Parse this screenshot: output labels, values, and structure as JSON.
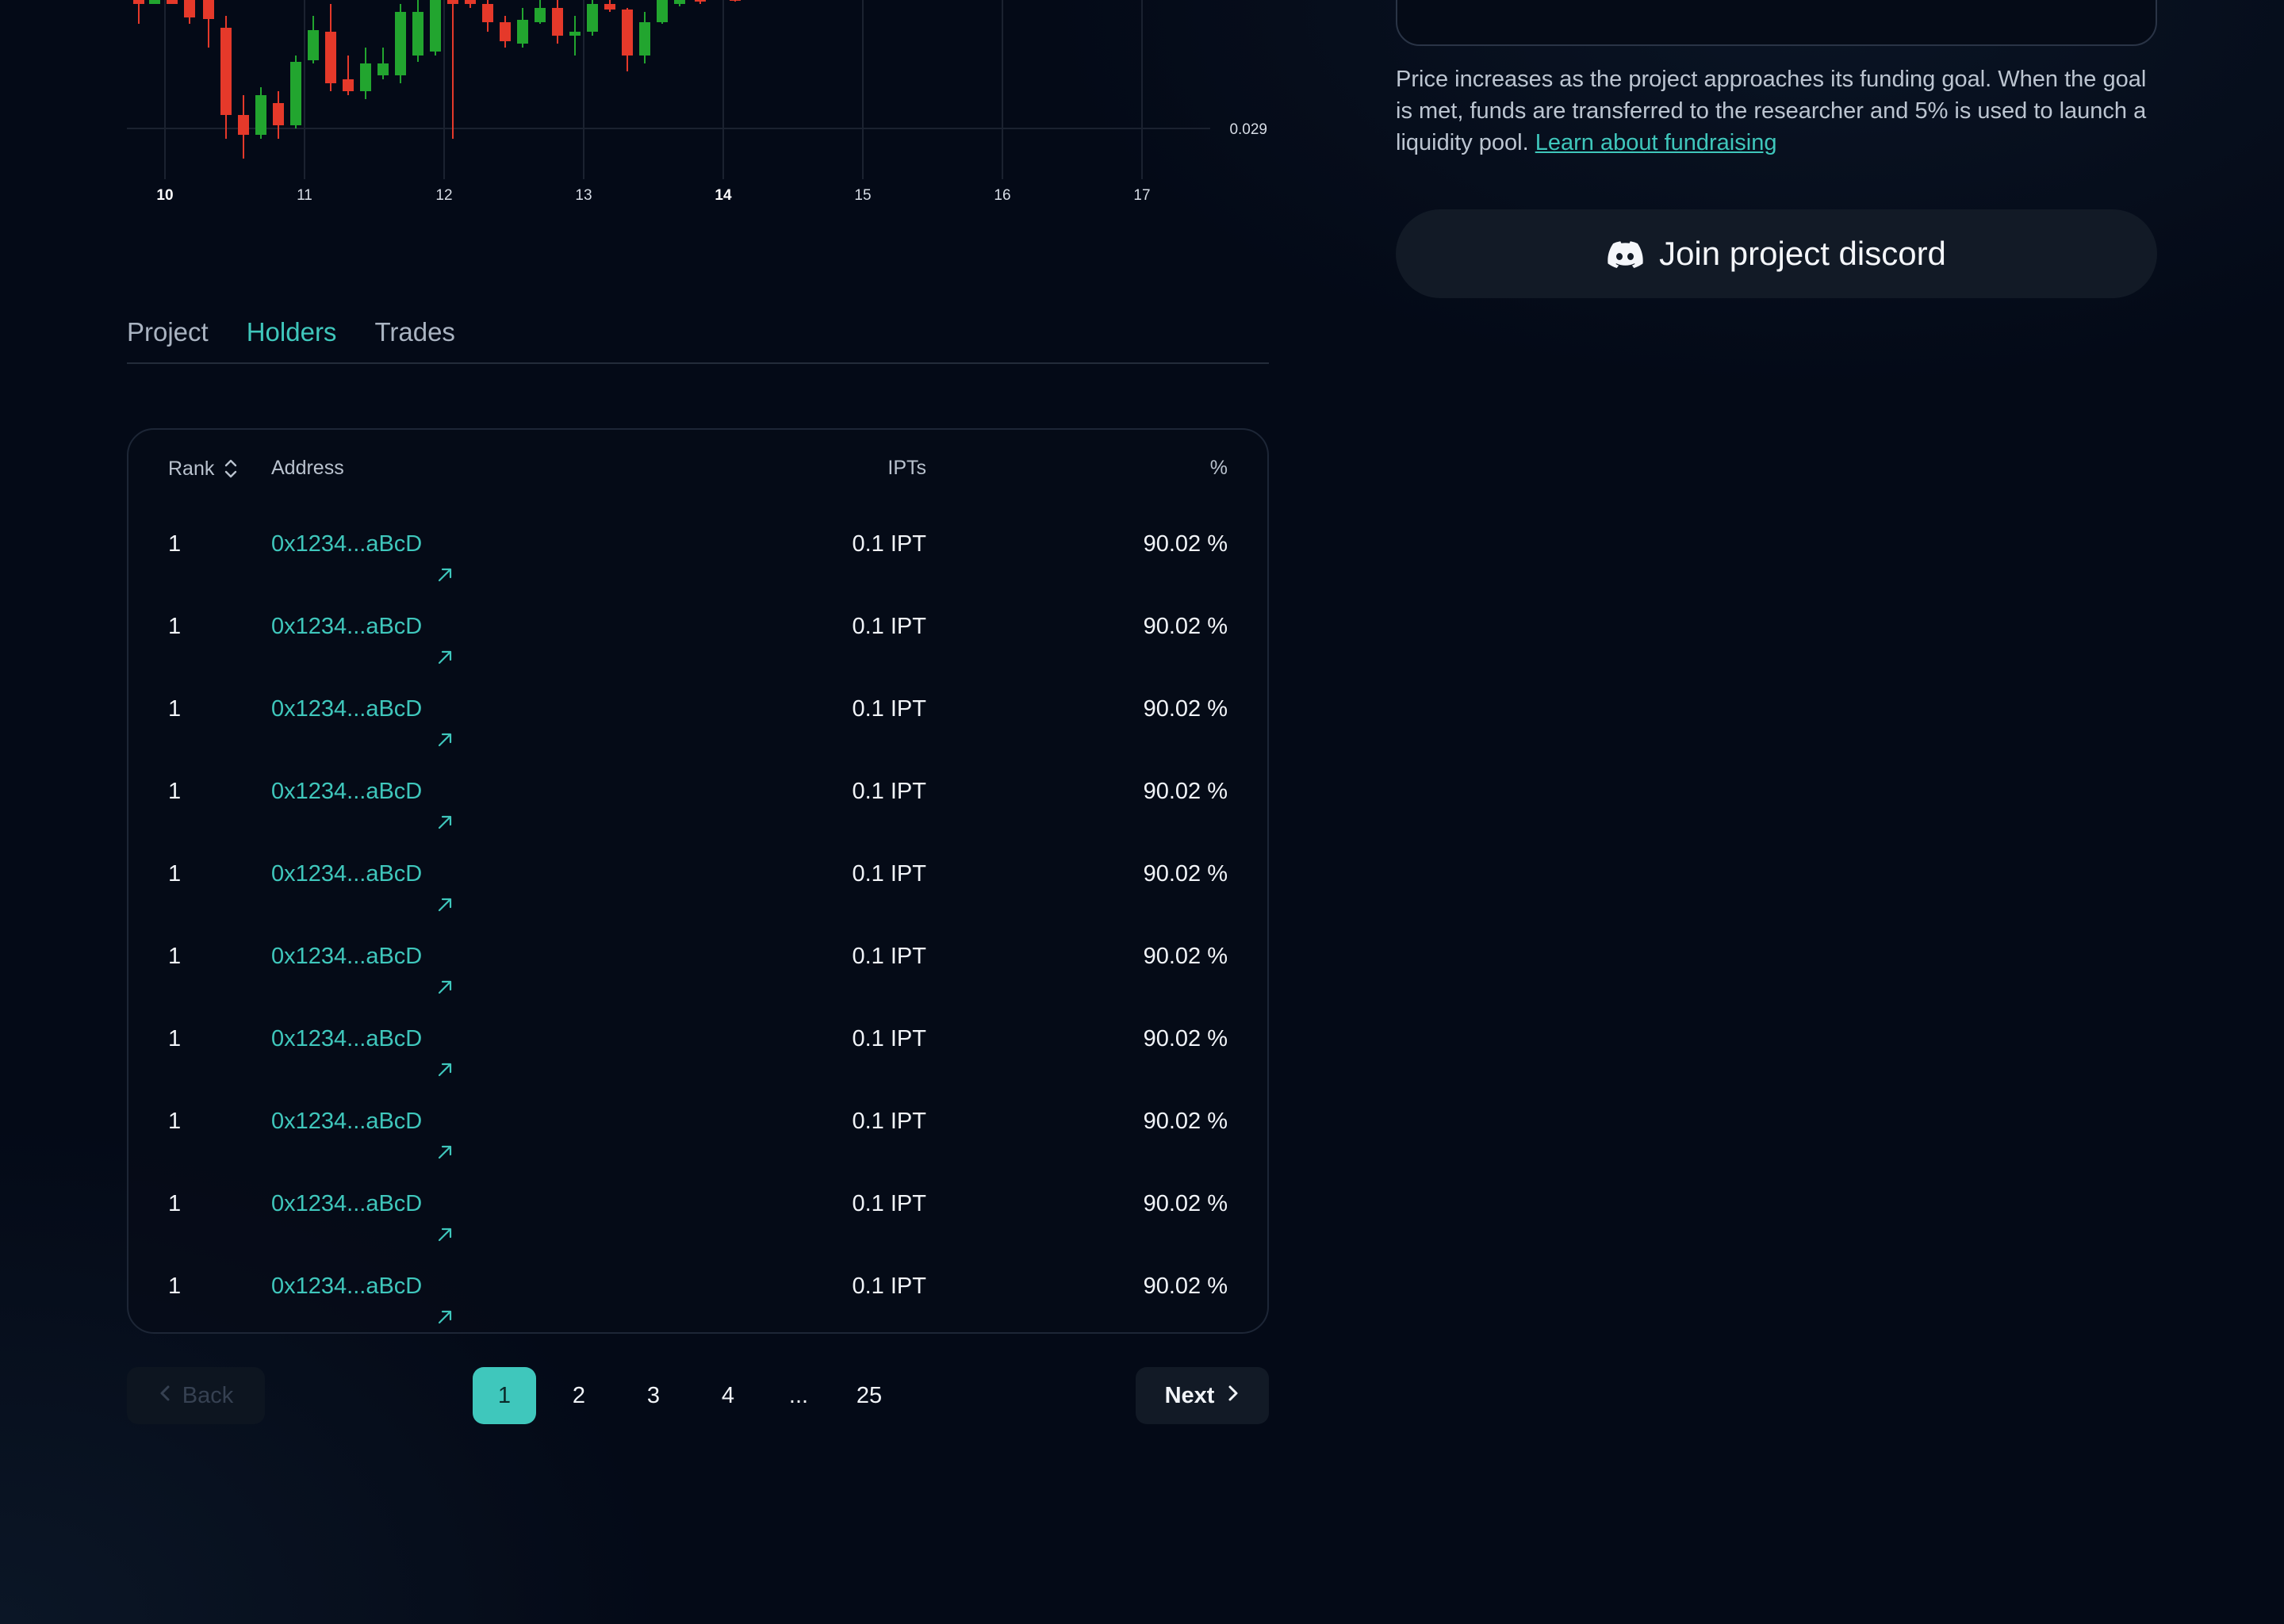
{
  "chart": {
    "price_label": "0.029",
    "x_ticks": [
      {
        "label": "10",
        "bold": true
      },
      {
        "label": "11",
        "bold": false
      },
      {
        "label": "12",
        "bold": false
      },
      {
        "label": "13",
        "bold": false
      },
      {
        "label": "14",
        "bold": true
      },
      {
        "label": "15",
        "bold": false
      },
      {
        "label": "16",
        "bold": false
      },
      {
        "label": "17",
        "bold": false
      }
    ],
    "colors": {
      "up": "#22a52f",
      "down": "#e5392a",
      "grid": "#1b2230"
    }
  },
  "tabs": [
    {
      "label": "Project",
      "active": false
    },
    {
      "label": "Holders",
      "active": true
    },
    {
      "label": "Trades",
      "active": false
    }
  ],
  "table": {
    "headers": {
      "rank": "Rank",
      "address": "Address",
      "ipts": "IPTs",
      "pct": "%"
    },
    "rows": [
      {
        "rank": "1",
        "address": "0x1234...aBcD",
        "ipts": "0.1 IPT",
        "pct": "90.02 %"
      },
      {
        "rank": "1",
        "address": "0x1234...aBcD",
        "ipts": "0.1 IPT",
        "pct": "90.02 %"
      },
      {
        "rank": "1",
        "address": "0x1234...aBcD",
        "ipts": "0.1 IPT",
        "pct": "90.02 %"
      },
      {
        "rank": "1",
        "address": "0x1234...aBcD",
        "ipts": "0.1 IPT",
        "pct": "90.02 %"
      },
      {
        "rank": "1",
        "address": "0x1234...aBcD",
        "ipts": "0.1 IPT",
        "pct": "90.02 %"
      },
      {
        "rank": "1",
        "address": "0x1234...aBcD",
        "ipts": "0.1 IPT",
        "pct": "90.02 %"
      },
      {
        "rank": "1",
        "address": "0x1234...aBcD",
        "ipts": "0.1 IPT",
        "pct": "90.02 %"
      },
      {
        "rank": "1",
        "address": "0x1234...aBcD",
        "ipts": "0.1 IPT",
        "pct": "90.02 %"
      },
      {
        "rank": "1",
        "address": "0x1234...aBcD",
        "ipts": "0.1 IPT",
        "pct": "90.02 %"
      },
      {
        "rank": "1",
        "address": "0x1234...aBcD",
        "ipts": "0.1 IPT",
        "pct": "90.02 %"
      }
    ]
  },
  "pagination": {
    "back_label": "Back",
    "next_label": "Next",
    "pages": [
      "1",
      "2",
      "3",
      "4",
      "...",
      "25"
    ],
    "current": "1"
  },
  "sidebar": {
    "note_text": "Price increases as the project approaches its funding goal. When the goal is met, funds are transferred to the researcher and 5% is used to launch a liquidity pool. ",
    "note_link": "Learn about fundraising",
    "discord_label": "Join project discord"
  },
  "colors": {
    "accent": "#3fc7bc",
    "background": "#040a17"
  }
}
